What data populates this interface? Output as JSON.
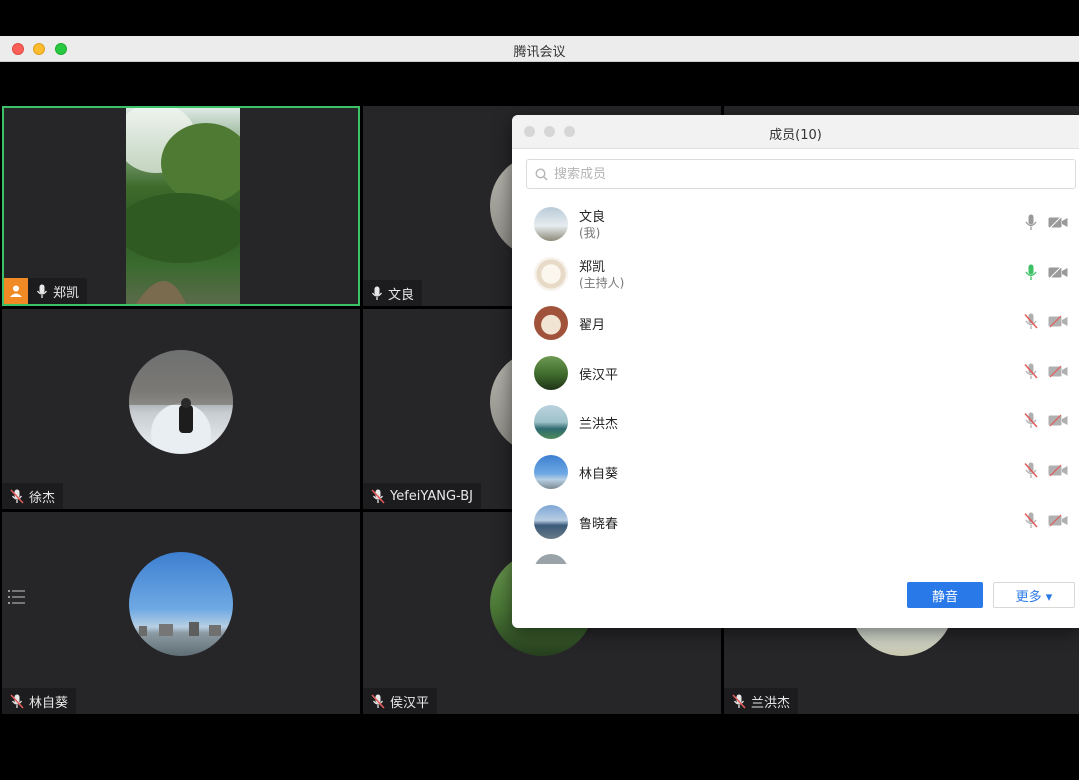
{
  "window": {
    "title": "腾讯会议"
  },
  "tiles": [
    {
      "name": "郑凯",
      "mic": "on",
      "host_badge": true,
      "active": true
    },
    {
      "name": "文良",
      "mic": "on"
    },
    {
      "name": "徐杰",
      "mic": "muted"
    },
    {
      "name": "YefeiYANG-BJ",
      "mic": "muted"
    },
    {
      "name": "林自葵",
      "mic": "muted"
    },
    {
      "name": "侯汉平",
      "mic": "muted"
    },
    {
      "name": "兰洪杰",
      "mic": "muted"
    }
  ],
  "members_panel": {
    "title": "成员(10)",
    "search_placeholder": "搜索成员",
    "members": [
      {
        "name": "文良",
        "sub": "(我)",
        "mic": "on",
        "mic_color": "#9a9a9a"
      },
      {
        "name": "郑凯",
        "sub": "(主持人)",
        "mic": "speaking",
        "mic_color": "#3cc166"
      },
      {
        "name": "翟月",
        "sub": "",
        "mic": "muted"
      },
      {
        "name": "侯汉平",
        "sub": "",
        "mic": "muted"
      },
      {
        "name": "兰洪杰",
        "sub": "",
        "mic": "muted"
      },
      {
        "name": "林自葵",
        "sub": "",
        "mic": "muted"
      },
      {
        "name": "鲁晓春",
        "sub": "",
        "mic": "muted"
      }
    ],
    "mute_label": "静音",
    "more_label": "更多 ▾"
  },
  "colors": {
    "accent": "#2a79e8",
    "active_border": "#3cc166",
    "muted_red": "#e25b5b"
  }
}
